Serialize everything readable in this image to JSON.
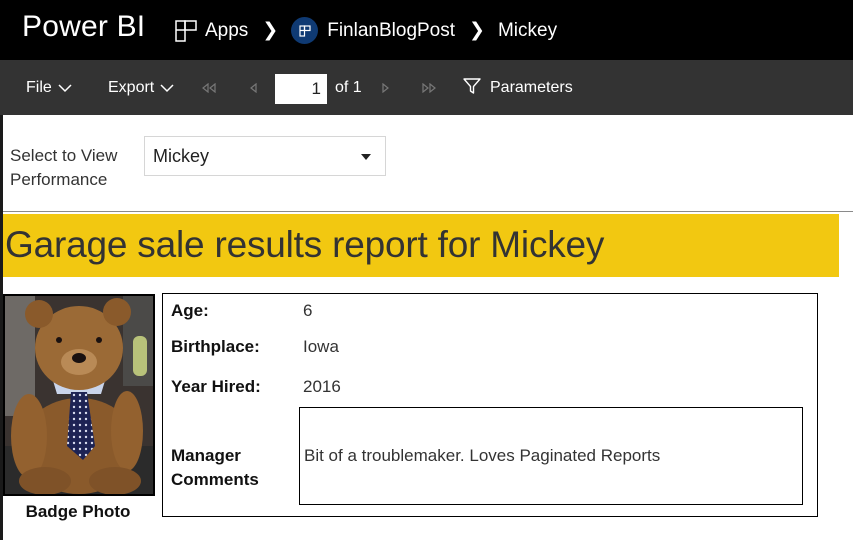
{
  "header": {
    "brand": "Power BI",
    "breadcrumb": [
      {
        "label": "Apps",
        "icon": "apps-grid-icon"
      },
      {
        "label": "FinlanBlogPost",
        "icon": "workspace-badge-icon"
      },
      {
        "label": "Mickey"
      }
    ],
    "separator_icon": "chevron-right-icon"
  },
  "toolbar": {
    "file_label": "File",
    "export_label": "Export",
    "first_page_icon": "first-page-icon",
    "prev_page_icon": "prev-page-icon",
    "current_page": "1",
    "of_label": "of 1",
    "next_page_icon": "next-page-icon",
    "last_page_icon": "last-page-icon",
    "parameters_label": "Parameters",
    "parameters_icon": "filter-icon"
  },
  "parameters": {
    "label": "Select to View Performance",
    "label_line1": "Select to View",
    "label_line2": "Performance",
    "selected": "Mickey"
  },
  "report": {
    "title": "Garage sale results report for Mickey",
    "photo_caption": "Badge Photo",
    "photo_description": "teddy bear wearing a dotted tie",
    "fields": [
      {
        "label": "Age:",
        "value": "6"
      },
      {
        "label": "Birthplace:",
        "value": "Iowa"
      },
      {
        "label": "Year Hired:",
        "value": "2016"
      }
    ],
    "comments_label_line1": "Manager",
    "comments_label_line2": "Comments",
    "comments": "Bit of a troublemaker.  Loves Paginated Reports"
  },
  "colors": {
    "accent_yellow": "#f2c811",
    "header_bg": "#000000",
    "toolbar_bg": "#333333",
    "workspace_badge": "#0f3a73"
  }
}
